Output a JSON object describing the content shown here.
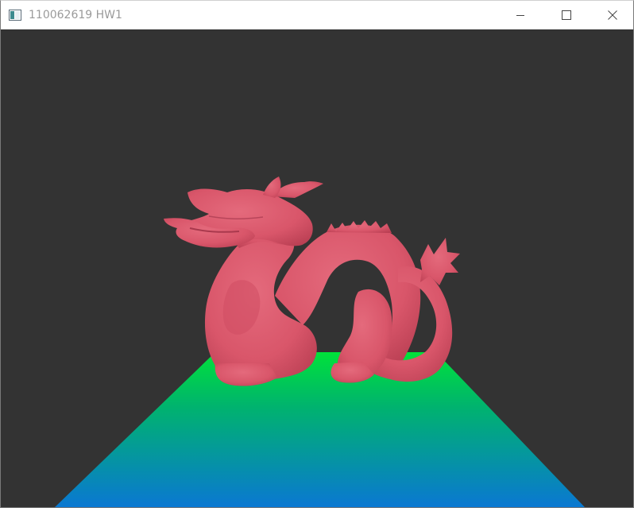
{
  "window": {
    "title": "110062619 HW1",
    "icons": {
      "app": "app-window-icon",
      "minimize": "minimize-icon",
      "maximize": "maximize-icon",
      "close": "close-icon"
    }
  },
  "scene": {
    "background_color": "#333333",
    "model_color": "#d9566a",
    "model_name_icon": "dragon-model",
    "floor_gradient": {
      "near_color": "#0a78d2",
      "far_color": "#00e23a"
    }
  }
}
